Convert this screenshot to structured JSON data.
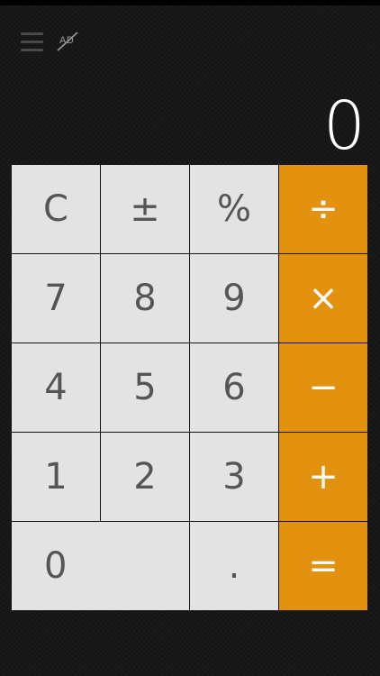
{
  "app": {
    "ad_label": "AD"
  },
  "display": {
    "value": "0"
  },
  "keys": {
    "clear": "C",
    "sign": "±",
    "percent": "%",
    "divide": "÷",
    "seven": "7",
    "eight": "8",
    "nine": "9",
    "multiply": "×",
    "four": "4",
    "five": "5",
    "six": "6",
    "minus": "−",
    "one": "1",
    "two": "2",
    "three": "3",
    "plus": "+",
    "zero": "0",
    "decimal": ".",
    "equals": "="
  },
  "icons": {
    "menu": "hamburger-menu-icon",
    "ad": "remove-ads-icon"
  },
  "colors": {
    "background": "#151515",
    "key": "#e3e3e3",
    "key_text": "#555555",
    "operator": "#e2920f",
    "operator_text": "#ffffff",
    "display_text": "#ffffff"
  }
}
